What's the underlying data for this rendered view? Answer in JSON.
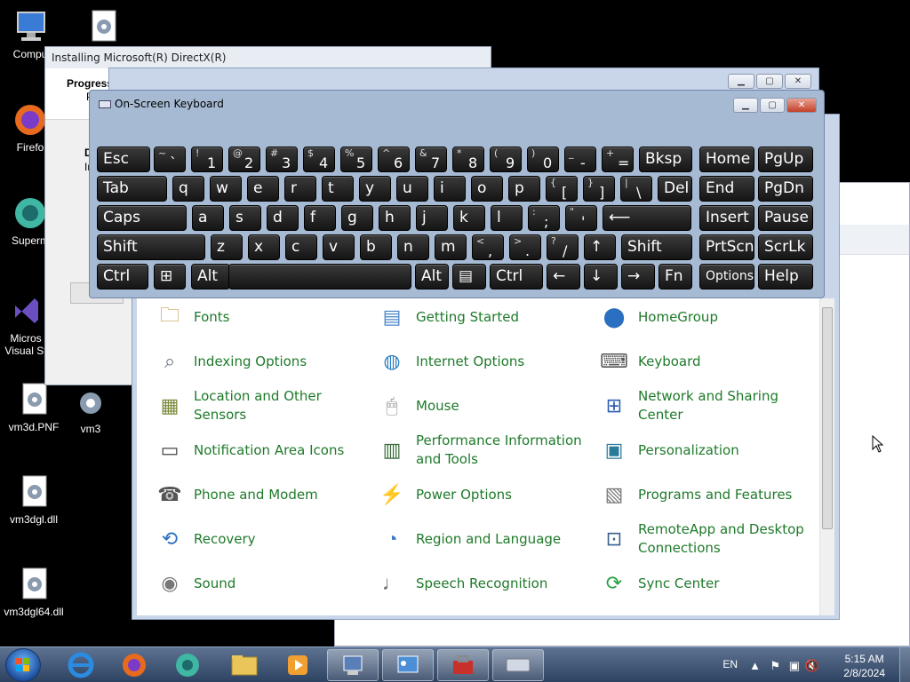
{
  "desktop": {
    "icons": [
      {
        "label": "Compu",
        "icon": "computer-icon"
      },
      {
        "label": "Firefo",
        "icon": "firefox-icon"
      },
      {
        "label": "Superm",
        "icon": "supermium-icon"
      },
      {
        "label": "Micros Visual St",
        "icon": "visual-studio-icon"
      },
      {
        "label": "vm3d.PNF",
        "icon": "settings-file-icon"
      },
      {
        "label": "vm3",
        "icon": "settings-file-icon"
      },
      {
        "label": "vm3dgl.dll",
        "icon": "settings-file-icon"
      },
      {
        "label": "vm3dgl64.dll",
        "icon": "settings-file-icon"
      }
    ]
  },
  "directx_window": {
    "title": "Installing Microsoft(R) DirectX(R)",
    "heading": "Progress",
    "heading_suffix": "P",
    "partial_text_1": "D",
    "partial_text_2": "In"
  },
  "osk": {
    "title": "On-Screen Keyboard",
    "rows": [
      [
        {
          "main": "Esc"
        },
        {
          "shift": "~",
          "base": "`"
        },
        {
          "shift": "!",
          "base": "1"
        },
        {
          "shift": "@",
          "base": "2"
        },
        {
          "shift": "#",
          "base": "3"
        },
        {
          "shift": "$",
          "base": "4"
        },
        {
          "shift": "%",
          "base": "5"
        },
        {
          "shift": "^",
          "base": "6"
        },
        {
          "shift": "&",
          "base": "7"
        },
        {
          "shift": "*",
          "base": "8"
        },
        {
          "shift": "(",
          "base": "9"
        },
        {
          "shift": ")",
          "base": "0"
        },
        {
          "shift": "_",
          "base": "-"
        },
        {
          "shift": "+",
          "base": "="
        },
        {
          "main": "Bksp"
        },
        {
          "main": "Home"
        },
        {
          "main": "PgUp"
        }
      ],
      [
        {
          "main": "Tab"
        },
        {
          "main": "q"
        },
        {
          "main": "w"
        },
        {
          "main": "e"
        },
        {
          "main": "r"
        },
        {
          "main": "t"
        },
        {
          "main": "y"
        },
        {
          "main": "u"
        },
        {
          "main": "i"
        },
        {
          "main": "o"
        },
        {
          "main": "p"
        },
        {
          "shift": "{",
          "base": "["
        },
        {
          "shift": "}",
          "base": "]"
        },
        {
          "shift": "|",
          "base": "\\"
        },
        {
          "main": "Del"
        },
        {
          "main": "End"
        },
        {
          "main": "PgDn"
        }
      ],
      [
        {
          "main": "Caps"
        },
        {
          "main": "a"
        },
        {
          "main": "s"
        },
        {
          "main": "d"
        },
        {
          "main": "f"
        },
        {
          "main": "g"
        },
        {
          "main": "h"
        },
        {
          "main": "j"
        },
        {
          "main": "k"
        },
        {
          "main": "l"
        },
        {
          "shift": ":",
          "base": ";"
        },
        {
          "shift": "\"",
          "base": "'"
        },
        {
          "main": "⟵"
        },
        {
          "main": "Insert"
        },
        {
          "main": "Pause"
        }
      ],
      [
        {
          "main": "Shift"
        },
        {
          "main": "z"
        },
        {
          "main": "x"
        },
        {
          "main": "c"
        },
        {
          "main": "v"
        },
        {
          "main": "b"
        },
        {
          "main": "n"
        },
        {
          "main": "m"
        },
        {
          "shift": "<",
          "base": ","
        },
        {
          "shift": ">",
          "base": "."
        },
        {
          "shift": "?",
          "base": "/"
        },
        {
          "main": "↑"
        },
        {
          "main": "Shift"
        },
        {
          "main": "PrtScn"
        },
        {
          "main": "ScrLk"
        }
      ],
      [
        {
          "main": "Ctrl"
        },
        {
          "main": "⊞"
        },
        {
          "main": "Alt"
        },
        {
          "main": ""
        },
        {
          "main": "Alt"
        },
        {
          "main": "▤"
        },
        {
          "main": "Ctrl"
        },
        {
          "main": "←"
        },
        {
          "main": "↓"
        },
        {
          "main": "→"
        },
        {
          "main": "Fn"
        },
        {
          "main": "Options"
        },
        {
          "main": "Help"
        }
      ]
    ]
  },
  "control_panel": {
    "items": [
      {
        "label": "Fonts",
        "icon": "fonts-icon"
      },
      {
        "label": "Getting Started",
        "icon": "getting-started-icon"
      },
      {
        "label": "HomeGroup",
        "icon": "homegroup-icon"
      },
      {
        "label": "Indexing Options",
        "icon": "indexing-options-icon"
      },
      {
        "label": "Internet Options",
        "icon": "internet-options-icon"
      },
      {
        "label": "Keyboard",
        "icon": "keyboard-icon"
      },
      {
        "label": "Location and Other Sensors",
        "icon": "location-sensors-icon"
      },
      {
        "label": "Mouse",
        "icon": "mouse-icon"
      },
      {
        "label": "Network and Sharing Center",
        "icon": "network-sharing-icon"
      },
      {
        "label": "Notification Area Icons",
        "icon": "notification-area-icon"
      },
      {
        "label": "Performance Information and Tools",
        "icon": "performance-icon"
      },
      {
        "label": "Personalization",
        "icon": "personalization-icon"
      },
      {
        "label": "Phone and Modem",
        "icon": "phone-modem-icon"
      },
      {
        "label": "Power Options",
        "icon": "power-options-icon"
      },
      {
        "label": "Programs and Features",
        "icon": "programs-features-icon"
      },
      {
        "label": "Recovery",
        "icon": "recovery-icon"
      },
      {
        "label": "Region and Language",
        "icon": "region-language-icon"
      },
      {
        "label": "RemoteApp and Desktop Connections",
        "icon": "remoteapp-icon"
      },
      {
        "label": "Sound",
        "icon": "sound-icon"
      },
      {
        "label": "Speech Recognition",
        "icon": "speech-recognition-icon"
      },
      {
        "label": "Sync Center",
        "icon": "sync-center-icon"
      }
    ]
  },
  "taskbar": {
    "apps": [
      "internet-explorer-icon",
      "firefox-icon",
      "supermium-icon",
      "file-explorer-icon",
      "media-player-icon",
      "installer-icon",
      "control-panel-icon",
      "toolbox-icon",
      "on-screen-keyboard-icon"
    ],
    "language": "EN",
    "time": "5:15 AM",
    "date": "2/8/2024"
  }
}
